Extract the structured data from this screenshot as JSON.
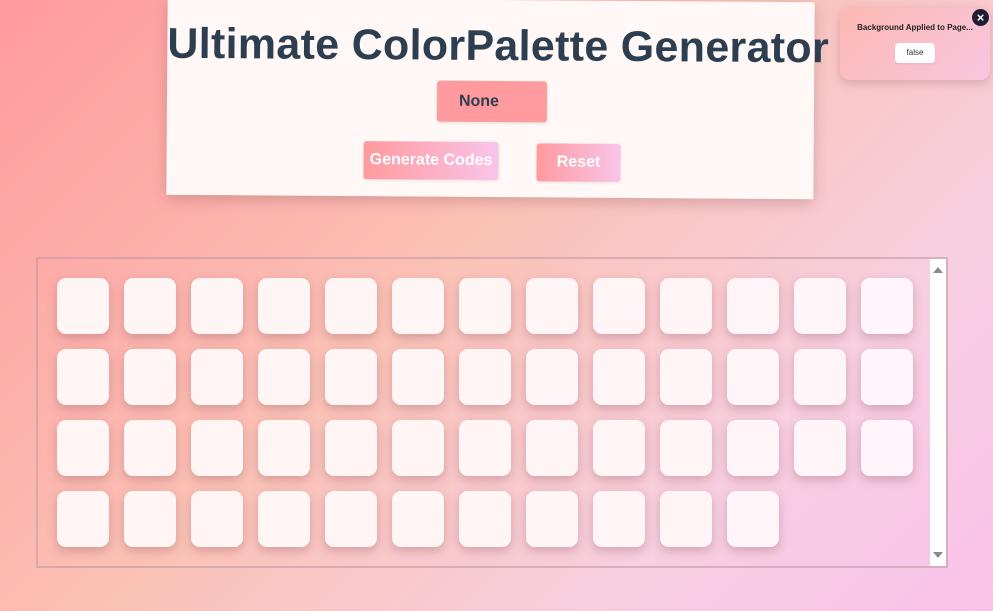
{
  "app": {
    "title": "Ultimate ColorPalette Generator"
  },
  "color_display": {
    "value": "None",
    "background": "#ff9a9e"
  },
  "buttons": {
    "generate_label": "Generate Codes",
    "reset_label": "Reset"
  },
  "notification": {
    "title": "Background Applied to Page...",
    "value": "false"
  },
  "swatches": {
    "count": 50,
    "colors": [
      "#fff5f4",
      "#fff5f4",
      "#fff5f4",
      "#fff5f4",
      "#fff5f4",
      "#fff5f5",
      "#fff5f5",
      "#fff5f6",
      "#fff5f7",
      "#fff5f7",
      "#fff5f8",
      "#fff5f9",
      "#fff5fa",
      "#fff5f4",
      "#fff5f4",
      "#fff5f4",
      "#fff5f4",
      "#fff5f4",
      "#fff5f5",
      "#fff5f5",
      "#fff5f6",
      "#fff5f7",
      "#fff5f7",
      "#fff5f8",
      "#fff5f9",
      "#fff5fa",
      "#fff5f4",
      "#fff5f4",
      "#fff5f4",
      "#fff5f4",
      "#fff5f4",
      "#fff5f5",
      "#fff5f5",
      "#fff5f6",
      "#fff5f7",
      "#fff5f7",
      "#fff5f8",
      "#fff5f9",
      "#fff5fa",
      "#fff5f4",
      "#fff5f4",
      "#fff5f4",
      "#fff5f4",
      "#fff5f4",
      "#fff5f5",
      "#fff5f5",
      "#fff5f6",
      "#fff5f7",
      "#fff5f7",
      "#fff5f8",
      "#fff5f9"
    ]
  },
  "colors": {
    "title_text": "#2c3e50",
    "page_gradient_start": "#ff9a9e",
    "page_gradient_end": "#f9c2ea",
    "close_button": "#1e1e33"
  }
}
